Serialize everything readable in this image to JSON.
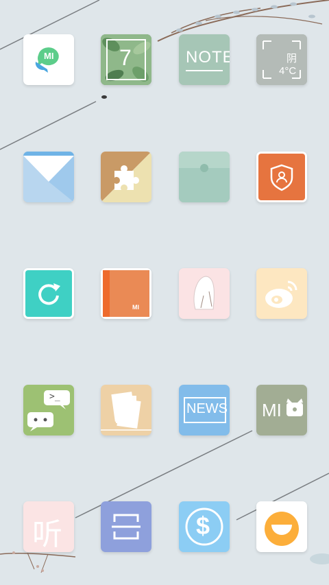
{
  "page_indicator": "•",
  "apps": {
    "mi_talk": {
      "name": "mi-talk-icon",
      "badge": "MI",
      "bg": "#ffffff"
    },
    "calendar": {
      "name": "calendar-icon",
      "day": "7"
    },
    "note": {
      "name": "notes-icon",
      "label": "NOTE"
    },
    "weather": {
      "name": "weather-icon",
      "condition": "阴",
      "temp": "4°C"
    },
    "mail": {
      "name": "mail-icon"
    },
    "puzzle": {
      "name": "puzzle-icon"
    },
    "wallet": {
      "name": "envelope-wallet-icon"
    },
    "security": {
      "name": "security-shield-icon"
    },
    "refresh": {
      "name": "updater-icon"
    },
    "mi_book": {
      "name": "mi-book-icon",
      "badge": "MI"
    },
    "gallery": {
      "name": "gallery-icon"
    },
    "weibo": {
      "name": "weibo-icon"
    },
    "chat": {
      "name": "chat-terminal-icon",
      "prompt": ">_"
    },
    "files": {
      "name": "file-manager-icon"
    },
    "news": {
      "name": "news-icon",
      "label": "NEWS"
    },
    "mi_home": {
      "name": "mi-home-icon",
      "label": "MI"
    },
    "music": {
      "name": "music-listen-icon",
      "label": "听"
    },
    "scanner": {
      "name": "scanner-icon"
    },
    "payment": {
      "name": "payment-icon",
      "symbol": "$"
    },
    "smile": {
      "name": "smile-app-icon"
    }
  }
}
